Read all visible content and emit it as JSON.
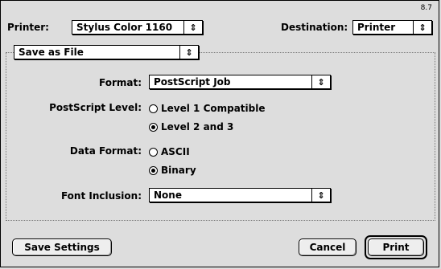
{
  "version": "8.7",
  "printer": {
    "label": "Printer:",
    "value": "Stylus Color 1160"
  },
  "destination": {
    "label": "Destination:",
    "value": "Printer"
  },
  "panel": {
    "value": "Save as File"
  },
  "format": {
    "label": "Format:",
    "value": "PostScript Job"
  },
  "postscript_level": {
    "label": "PostScript Level:",
    "options": [
      "Level 1 Compatible",
      "Level 2 and 3"
    ],
    "selected": "Level 2 and 3"
  },
  "data_format": {
    "label": "Data Format:",
    "options": [
      "ASCII",
      "Binary"
    ],
    "selected": "Binary"
  },
  "font_inclusion": {
    "label": "Font Inclusion:",
    "value": "None"
  },
  "buttons": {
    "save_settings": "Save Settings",
    "cancel": "Cancel",
    "print": "Print"
  }
}
